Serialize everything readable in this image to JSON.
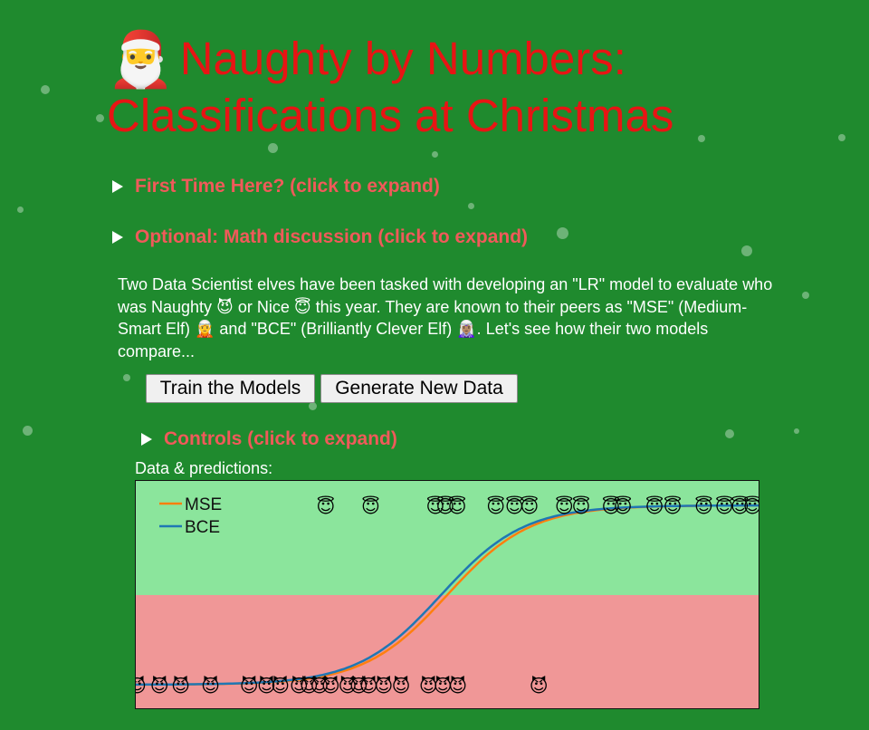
{
  "header": {
    "title_icon": "🎅",
    "title": "Naughty by Numbers: Classifications at Christmas"
  },
  "sections": {
    "first_time": "First Time Here? (click to expand)",
    "math": "Optional: Math discussion (click to expand)",
    "controls": "Controls (click to expand)"
  },
  "intro": {
    "text": "Two Data Scientist elves have been tasked with developing an \"LR\" model to evaluate who was Naughty 😈 or Nice 😇 this year. They are known to their peers as \"MSE\" (Medium-Smart Elf) 🧝 and \"BCE\" (Brilliantly Clever Elf) 🧝🏽‍♀️. Let's see how their two models compare..."
  },
  "buttons": {
    "train": "Train the Models",
    "generate": "Generate New Data"
  },
  "plot": {
    "label": "Data & predictions:"
  },
  "colors": {
    "background": "#1f8a2e",
    "title": "#e81414",
    "section_heading": "#f05a5a",
    "nice_region": "#8be59c",
    "naughty_region": "#f09797",
    "mse_line": "#ff7f0e",
    "bce_line": "#1f77b4"
  },
  "chart_data": {
    "type": "scatter",
    "title": "",
    "xlabel": "",
    "ylabel": "",
    "xlim": [
      0,
      1
    ],
    "ylim": [
      0,
      1
    ],
    "grid": false,
    "legend": "top-left",
    "series": [
      {
        "name": "MSE",
        "kind": "line",
        "color": "#ff7f0e",
        "midpoint": 0.5,
        "steepness": 15
      },
      {
        "name": "BCE",
        "kind": "line",
        "color": "#1f77b4",
        "midpoint": 0.49,
        "steepness": 15
      }
    ],
    "points": {
      "nice_icon": "😇",
      "naughty_icon": "😈",
      "nice_x": [
        0.305,
        0.377,
        0.481,
        0.497,
        0.516,
        0.578,
        0.608,
        0.632,
        0.688,
        0.715,
        0.763,
        0.782,
        0.833,
        0.862,
        0.912,
        0.945,
        0.97,
        0.99
      ],
      "naughty_x": [
        0.002,
        0.038,
        0.072,
        0.12,
        0.182,
        0.21,
        0.232,
        0.262,
        0.278,
        0.295,
        0.313,
        0.34,
        0.358,
        0.374,
        0.398,
        0.426,
        0.47,
        0.493,
        0.517,
        0.647
      ]
    }
  }
}
